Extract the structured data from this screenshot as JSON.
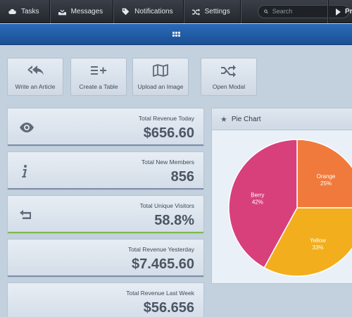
{
  "nav": {
    "items": [
      {
        "label": "Tasks",
        "icon": "cloud-icon"
      },
      {
        "label": "Messages",
        "icon": "inbox-icon"
      },
      {
        "label": "Notifications",
        "icon": "tag-icon"
      },
      {
        "label": "Settings",
        "icon": "shuffle-icon"
      }
    ],
    "search_placeholder": "Search",
    "profile_label": "Pr"
  },
  "shortcuts": [
    {
      "label": "Write an Article",
      "icon": "reply-all-icon"
    },
    {
      "label": "Create a Table",
      "icon": "list-add-icon"
    },
    {
      "label": "Upload an Image",
      "icon": "map-icon"
    },
    {
      "label": "Open Modal",
      "icon": "shuffle-icon"
    }
  ],
  "stats": [
    {
      "label": "Total Revenue Today",
      "value": "$656.60",
      "icon": "eye-icon"
    },
    {
      "label": "Total New Members",
      "value": "856",
      "icon": "info-icon"
    },
    {
      "label": "Total Unique Visitors",
      "value": "58.8%",
      "icon": "return-icon"
    },
    {
      "label": "Total Revenue Yesterday",
      "value": "$7.465.60",
      "icon": ""
    },
    {
      "label": "Total Revenue Last Week",
      "value": "$56.656",
      "icon": ""
    }
  ],
  "pie_panel": {
    "title": "Pie Chart"
  },
  "chart_data": {
    "type": "pie",
    "title": "Pie Chart",
    "slices": [
      {
        "name": "Orange",
        "value": 25,
        "label": "25%",
        "color": "#f07a3c"
      },
      {
        "name": "Yellow",
        "value": 33,
        "label": "33%",
        "color": "#f2ae1c"
      },
      {
        "name": "Berry",
        "value": 42,
        "label": "42%",
        "color": "#d8407c"
      }
    ]
  },
  "colors": {
    "blue_bar": "#2a6bb8",
    "stat_accent": "#7d8ea9",
    "stat_accent_green": "#7fba4e",
    "background": "#c3d0de"
  }
}
